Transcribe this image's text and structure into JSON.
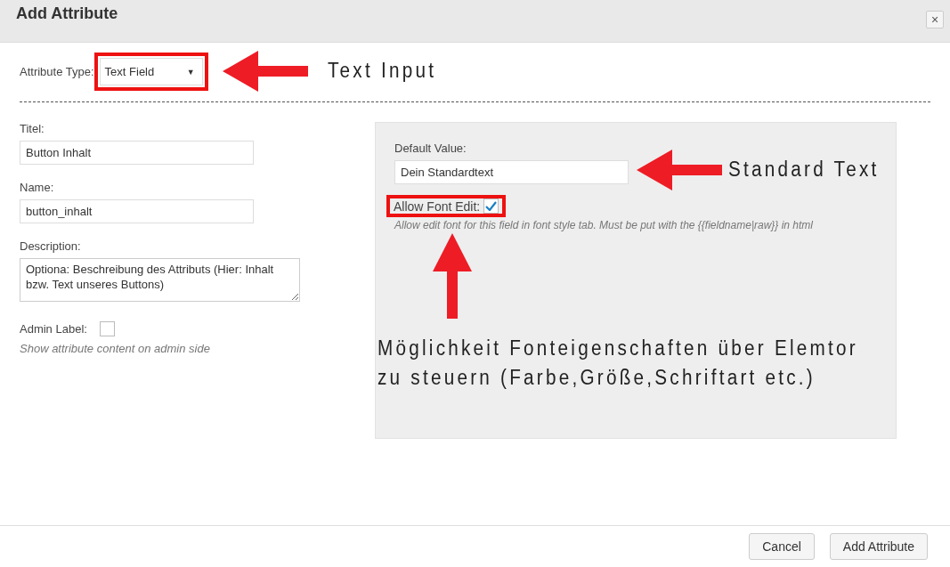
{
  "dialog": {
    "title": "Add Attribute",
    "close": "×"
  },
  "attribute_type": {
    "label": "Attribute Type:",
    "value": "Text Field",
    "caret": "▼",
    "highlighted": true,
    "annotation": "Text Input"
  },
  "fields": [
    {
      "label": "Titel:",
      "value": "Button Inhalt",
      "kind": "input"
    },
    {
      "label": "Name:",
      "value": "button_inhalt",
      "kind": "input"
    },
    {
      "label": "Description:",
      "value": "Optiona: Beschreibung des Attributs (Hier: Inhalt bzw. Text unseres Buttons)",
      "kind": "textarea"
    }
  ],
  "admin_label": {
    "label": "Admin Label:",
    "checked": false,
    "hint": "Show attribute content on admin side"
  },
  "default_value": {
    "label": "Default Value:",
    "value": "Dein Standardtext",
    "annotation": "Standard Text"
  },
  "allow_font_edit": {
    "label": "Allow Font Edit:",
    "checked": true,
    "highlighted": true,
    "hint": "Allow edit font for this field in font style tab. Must be put with the {{fieldname|raw}} in html",
    "annotation_lines": [
      "Möglichkeit Fonteigenschaften über Elemtor",
      "zu steuern (Farbe,Größe,Schriftart etc.)"
    ]
  },
  "buttons": [
    {
      "label": "Cancel"
    },
    {
      "label": "Add Attribute"
    }
  ]
}
